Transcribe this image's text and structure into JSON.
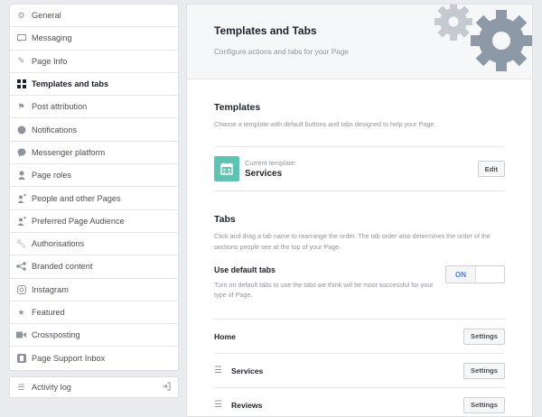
{
  "sidebar": {
    "items": [
      {
        "label": "General",
        "icon": "gear-icon"
      },
      {
        "label": "Messaging",
        "icon": "message-icon"
      },
      {
        "label": "Page Info",
        "icon": "pencil-icon"
      },
      {
        "label": "Templates and tabs",
        "icon": "grid-icon",
        "active": true
      },
      {
        "label": "Post attribution",
        "icon": "flag-icon"
      },
      {
        "label": "Notifications",
        "icon": "globe-icon"
      },
      {
        "label": "Messenger platform",
        "icon": "messenger-icon"
      },
      {
        "label": "Page roles",
        "icon": "person-icon"
      },
      {
        "label": "People and other Pages",
        "icon": "person-plus-icon"
      },
      {
        "label": "Preferred Page Audience",
        "icon": "person-plus-icon"
      },
      {
        "label": "Authorisations",
        "icon": "wrench-icon"
      },
      {
        "label": "Branded content",
        "icon": "branded-content-icon"
      },
      {
        "label": "Instagram",
        "icon": "instagram-icon"
      },
      {
        "label": "Featured",
        "icon": "star-icon"
      },
      {
        "label": "Crossposting",
        "icon": "video-icon"
      },
      {
        "label": "Page Support Inbox",
        "icon": "page-support-icon"
      }
    ],
    "activity_log": "Activity log"
  },
  "header": {
    "title": "Templates and Tabs",
    "subtitle": "Configure actions and tabs for your Page"
  },
  "templates": {
    "title": "Templates",
    "description": "Choose a template with default buttons and tabs designed to help your Page.",
    "current_label": "Current template:",
    "current_name": "Services",
    "edit_label": "Edit"
  },
  "tabs": {
    "title": "Tabs",
    "description": "Click and drag a tab name to rearrange the order. The tab order also determines the order of the sections people see at the top of your Page.",
    "use_default_title": "Use default tabs",
    "use_default_desc": "Turn on default tabs to use the tabs we think will be most successful for your type of Page.",
    "toggle_label": "ON",
    "rows": [
      {
        "name": "Home",
        "draggable": false,
        "settings": "Settings"
      },
      {
        "name": "Services",
        "draggable": true,
        "settings": "Settings"
      },
      {
        "name": "Reviews",
        "draggable": true,
        "settings": "Settings"
      }
    ]
  },
  "colors": {
    "accent": "#4080ff",
    "template_icon_bg": "#5ec3b2",
    "gear_light": "#c5cad1",
    "gear_dark": "#8d99a6"
  }
}
